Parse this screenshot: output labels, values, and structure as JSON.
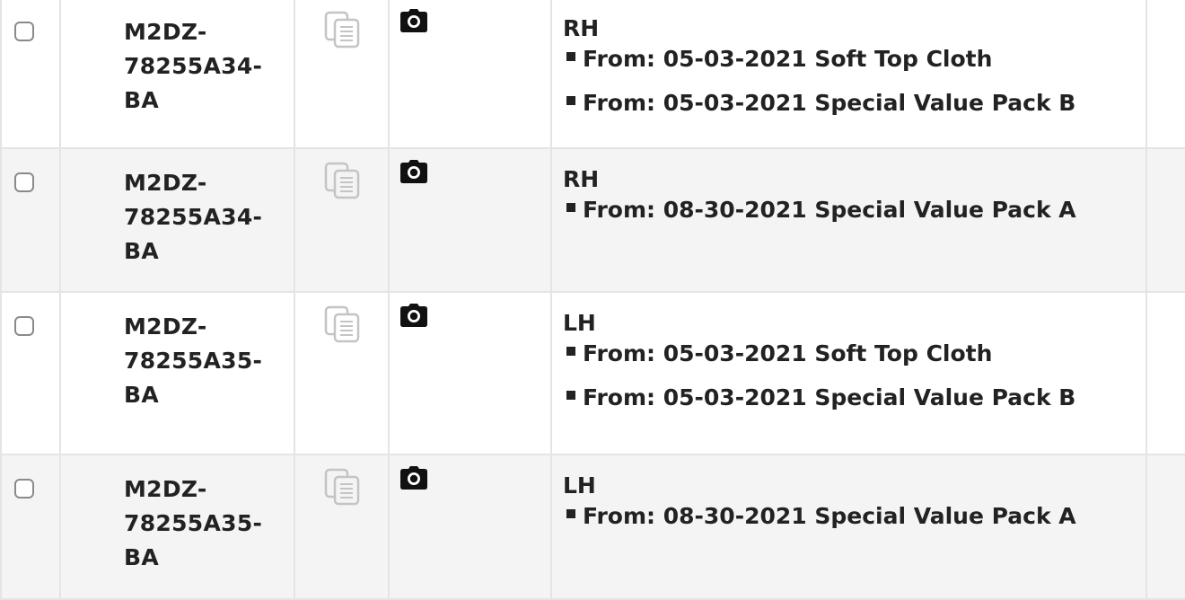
{
  "rows": [
    {
      "part_lines": [
        "M2DZ-",
        "78255A34-",
        "BA"
      ],
      "side": "RH",
      "items": [
        "From: 05-03-2021 Soft Top Cloth",
        "From: 05-03-2021 Special Value Pack B"
      ]
    },
    {
      "part_lines": [
        "M2DZ-",
        "78255A34-",
        "BA"
      ],
      "side": "RH",
      "items": [
        "From: 08-30-2021 Special Value Pack A"
      ]
    },
    {
      "part_lines": [
        "M2DZ-",
        "78255A35-",
        "BA"
      ],
      "side": "LH",
      "items": [
        "From: 05-03-2021 Soft Top Cloth",
        "From: 05-03-2021 Special Value Pack B"
      ]
    },
    {
      "part_lines": [
        "M2DZ-",
        "78255A35-",
        "BA"
      ],
      "side": "LH",
      "items": [
        "From: 08-30-2021 Special Value Pack A"
      ]
    }
  ],
  "icons": {
    "copy": "copy-icon",
    "camera": "camera-icon"
  },
  "colors": {
    "row_alt_bg": "#f4f4f4",
    "border": "#e4e4e4",
    "text": "#222222",
    "copy_icon": "#bdbdbd"
  }
}
